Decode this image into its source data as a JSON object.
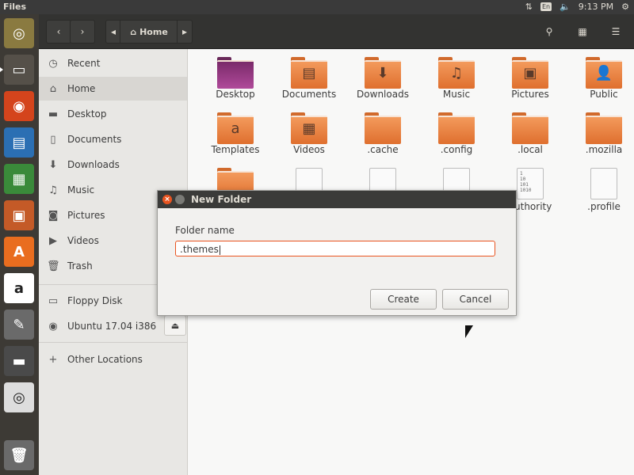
{
  "topbar": {
    "title": "Files",
    "keyboard": "En",
    "time": "9:13 PM"
  },
  "launcher": {
    "items": [
      {
        "name": "ubuntu-dash",
        "color": "#8a7a40"
      },
      {
        "name": "files",
        "color": "#555049"
      },
      {
        "name": "firefox",
        "color": "#d4441c"
      },
      {
        "name": "writer",
        "color": "#2b6fb3"
      },
      {
        "name": "calc",
        "color": "#3a8a3a"
      },
      {
        "name": "impress",
        "color": "#c45a27"
      },
      {
        "name": "software",
        "color": "#e96d1f"
      },
      {
        "name": "amazon",
        "color": "#ffffff"
      },
      {
        "name": "settings",
        "color": "#6a6a6a"
      },
      {
        "name": "floppy",
        "color": "#4a4a4a"
      },
      {
        "name": "dvd",
        "color": "#dddddd"
      },
      {
        "name": "trash",
        "color": "#6a6a6a"
      }
    ]
  },
  "header": {
    "location": "Home"
  },
  "sidebar": {
    "items": [
      {
        "label": "Recent",
        "icon": "clock-icon"
      },
      {
        "label": "Home",
        "icon": "home-icon"
      },
      {
        "label": "Desktop",
        "icon": "folder-icon"
      },
      {
        "label": "Documents",
        "icon": "document-icon"
      },
      {
        "label": "Downloads",
        "icon": "download-icon"
      },
      {
        "label": "Music",
        "icon": "music-icon"
      },
      {
        "label": "Pictures",
        "icon": "camera-icon"
      },
      {
        "label": "Videos",
        "icon": "video-icon"
      },
      {
        "label": "Trash",
        "icon": "trash-icon"
      }
    ],
    "devices": [
      {
        "label": "Floppy Disk",
        "icon": "floppy-icon"
      },
      {
        "label": "Ubuntu 17.04 i386",
        "icon": "disc-icon"
      }
    ],
    "other": {
      "label": "Other Locations",
      "icon": "plus-icon"
    }
  },
  "files": [
    {
      "label": "Desktop",
      "kind": "folder",
      "glyph": ""
    },
    {
      "label": "Documents",
      "kind": "folder",
      "glyph": "▤"
    },
    {
      "label": "Downloads",
      "kind": "folder",
      "glyph": "⬇"
    },
    {
      "label": "Music",
      "kind": "folder",
      "glyph": "♫"
    },
    {
      "label": "Pictures",
      "kind": "folder",
      "glyph": "▣"
    },
    {
      "label": "Public",
      "kind": "folder",
      "glyph": "👤"
    },
    {
      "label": "Templates",
      "kind": "folder",
      "glyph": "a"
    },
    {
      "label": "Videos",
      "kind": "folder",
      "glyph": "▦"
    },
    {
      "label": ".cache",
      "kind": "folder",
      "glyph": ""
    },
    {
      "label": ".config",
      "kind": "folder",
      "glyph": ""
    },
    {
      "label": ".local",
      "kind": "folder",
      "glyph": ""
    },
    {
      "label": ".mozilla",
      "kind": "folder",
      "glyph": ""
    },
    {
      "label": "",
      "kind": "folder",
      "glyph": ""
    },
    {
      "label": "",
      "kind": "doc",
      "glyph": ""
    },
    {
      "label": "",
      "kind": "doc",
      "glyph": ""
    },
    {
      "label": "",
      "kind": "doc",
      "glyph": ""
    },
    {
      "label": "authority",
      "kind": "binary",
      "glyph": "1\n10\n101\n1010"
    },
    {
      "label": ".profile",
      "kind": "doc",
      "glyph": ""
    }
  ],
  "dialog": {
    "title": "New Folder",
    "field_label": "Folder name",
    "field_value": ".themes",
    "create_label": "Create",
    "cancel_label": "Cancel"
  }
}
